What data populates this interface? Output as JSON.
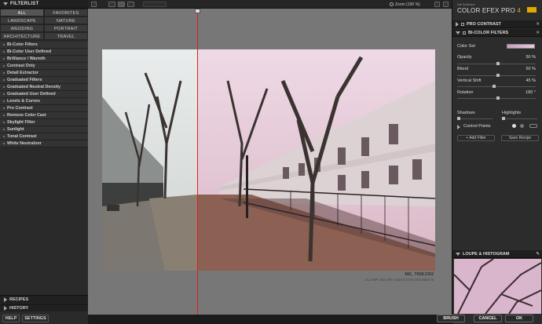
{
  "left_panel": {
    "filterlist_label": "FILTERLIST",
    "categories": [
      "ALL",
      "FAVORITES",
      "LANDSCAPE",
      "NATURE",
      "WEDDING",
      "PORTRAIT",
      "ARCHITECTURE",
      "TRAVEL"
    ],
    "filters": [
      "Bi-Color Filters",
      "Bi-Color User Defined",
      "Brilliance / Warmth",
      "Contrast Only",
      "Detail Extractor",
      "Graduated Filters",
      "Graduated Neutral Density",
      "Graduated User Defined",
      "Levels & Curves",
      "Pro Contrast",
      "Remove Color Cast",
      "Skylight Filter",
      "Sunlight",
      "Tonal Contrast",
      "White Neutralizer"
    ],
    "recipes_label": "RECIPES",
    "history_label": "HISTORY",
    "help_label": "HELP",
    "settings_label": "SETTINGS"
  },
  "toolbar": {
    "zoom_label": "Zoom (100 %)"
  },
  "canvas": {
    "file_name": "MG_7958.CR2",
    "file_meta": "21.2 MP, ISO 400, Canon EOS-1Ds Mark III"
  },
  "right_panel": {
    "brand_top": "Nik Software",
    "brand_name": "COLOR EFEX PRO",
    "brand_version": "4",
    "pro_contrast_label": "PRO CONTRAST",
    "bicolor_label": "BI-COLOR FILTERS",
    "controls": {
      "color_set_label": "Color Set",
      "opacity_label": "Opacity",
      "opacity_value": "50 %",
      "blend_label": "Blend",
      "blend_value": "50 %",
      "vshift_label": "Vertical Shift",
      "vshift_value": "45 %",
      "rotation_label": "Rotation",
      "rotation_value": "180 °",
      "shadows_label": "Shadows",
      "highlights_label": "Highlights",
      "control_points_label": "Control Points"
    },
    "add_filter_label": "+ Add Filter",
    "save_recipe_label": "Save Recipe",
    "loupe_label": "LOUPE & HISTOGRAM"
  },
  "bottom_bar": {
    "brush_label": "BRUSH",
    "cancel_label": "CANCEL",
    "ok_label": "OK"
  },
  "colors": {
    "split_line": "#e02020",
    "color_set_swatch": "#d4b0cc",
    "brand_accent": "#e0a800"
  }
}
